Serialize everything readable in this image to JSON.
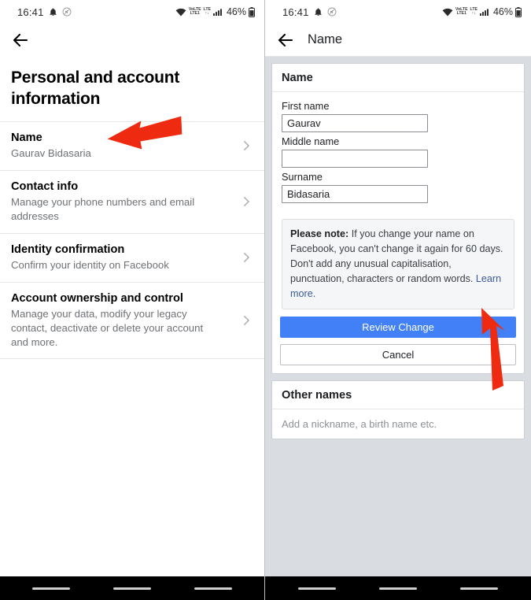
{
  "status_bar": {
    "time": "16:41",
    "battery": "46%",
    "icons": [
      "bell-icon",
      "mute-circle-icon",
      "wifi-icon",
      "volte-icon",
      "lte-icon",
      "signal-bars-icon",
      "battery-icon"
    ],
    "volte_label": "VoLTE",
    "lte_label": "LTE",
    "lte1_label": "LTE1"
  },
  "left_screen": {
    "back_label": "",
    "page_title": "Personal and account information",
    "items": [
      {
        "title": "Name",
        "subtitle": "Gaurav Bidasaria"
      },
      {
        "title": "Contact info",
        "subtitle": "Manage your phone numbers and email addresses"
      },
      {
        "title": "Identity confirmation",
        "subtitle": "Confirm your identity on Facebook"
      },
      {
        "title": "Account ownership and control",
        "subtitle": "Manage your data, modify your legacy contact, deactivate or delete your account and more."
      }
    ]
  },
  "right_screen": {
    "appbar_title": "Name",
    "name_card": {
      "header": "Name",
      "fields": [
        {
          "label": "First name",
          "value": "Gaurav",
          "placeholder": ""
        },
        {
          "label": "Middle name",
          "value": "",
          "placeholder": ""
        },
        {
          "label": "Surname",
          "value": "Bidasaria",
          "placeholder": ""
        }
      ],
      "note_bold": "Please note:",
      "note_text": " If you change your name on Facebook, you can't change it again for 60 days. Don't add any unusual capitalisation, punctuation, characters or random words. ",
      "note_link": "Learn more.",
      "primary_button": "Review Change",
      "secondary_button": "Cancel"
    },
    "other_names_card": {
      "header": "Other names",
      "row_text": "Add a nickname, a birth name etc."
    }
  },
  "colors": {
    "primary_blue": "#4180f7",
    "link_blue": "#3b5998",
    "page_bg": "#d9dce1",
    "annotation_red": "#ee2b10"
  }
}
